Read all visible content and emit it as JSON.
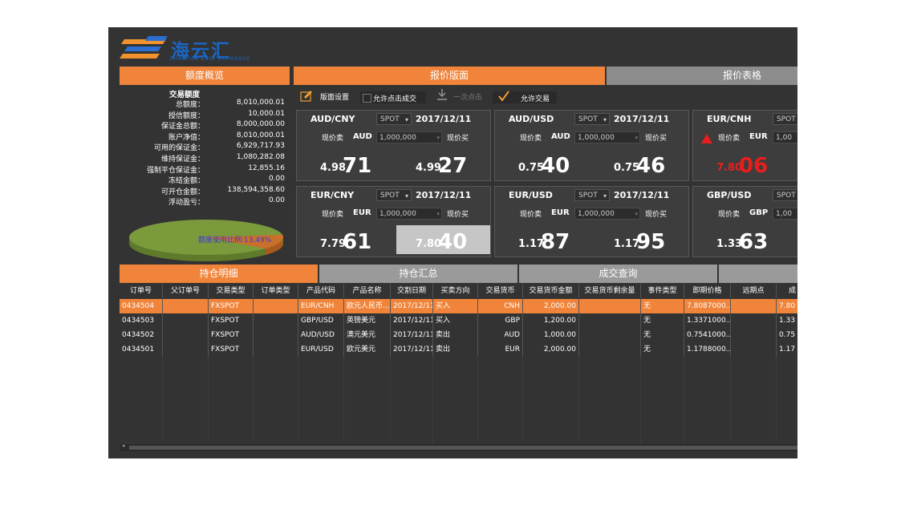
{
  "app": {
    "logo_text": "海云汇",
    "logo_subtitle": "ZHAOYUN BUSI EXCHANGE"
  },
  "tabs_top": {
    "quota_overview": "额度概览",
    "quote_board": "报价版面",
    "quote_table": "报价表格"
  },
  "quota": {
    "title": "交易额度",
    "rows": [
      {
        "label": "总额度：",
        "value": "8,010,000.01"
      },
      {
        "label": "授信额度：",
        "value": "10,000.01"
      },
      {
        "label": "保证金总额：",
        "value": "8,000,000.00"
      },
      {
        "label": "账户净值：",
        "value": "8,010,000.01"
      },
      {
        "label": "可用的保证金：",
        "value": "6,929,717.93"
      },
      {
        "label": "维持保证金：",
        "value": "1,080,282.08"
      },
      {
        "label": "强制平仓保证金：",
        "value": "12,855.16"
      },
      {
        "label": "冻结金额：",
        "value": "0.00"
      },
      {
        "label": "可开仓金额：",
        "value": "138,594,358.60"
      },
      {
        "label": "浮动盈亏：",
        "value": "0.00"
      }
    ],
    "usage_label": "额度使用比例:13.49%",
    "usage_ratio": 0.1349,
    "colors": {
      "used": "#c9702a",
      "free": "#7a9a3b"
    }
  },
  "toolbar": {
    "board_settings": "版面设置",
    "allow_click_deal": "允许点击成交",
    "one_click": "一次点击",
    "allow_trade": "允许交易"
  },
  "cards": [
    {
      "pair": "AUD/CNY",
      "type": "SPOT",
      "date": "2017/12/11",
      "sell_label": "现价卖",
      "ccy": "AUD",
      "amount": "1,000,000",
      "buy_label": "现价买",
      "sell_pre": "4.98",
      "sell_big": "71",
      "buy_pre": "4.99",
      "buy_big": "27"
    },
    {
      "pair": "AUD/USD",
      "type": "SPOT",
      "date": "2017/12/11",
      "sell_label": "现价卖",
      "ccy": "AUD",
      "amount": "1,000,000",
      "buy_label": "现价买",
      "sell_pre": "0.75",
      "sell_big": "40",
      "buy_pre": "0.75",
      "buy_big": "46"
    },
    {
      "pair": "EUR/CNH",
      "type": "SPOT",
      "date": "",
      "sell_label": "现价卖",
      "ccy": "EUR",
      "amount": "1,00",
      "buy_label": "",
      "sell_pre": "7.80",
      "sell_big": "06",
      "buy_pre": "",
      "buy_big": ""
    },
    {
      "pair": "EUR/CNY",
      "type": "SPOT",
      "date": "2017/12/11",
      "sell_label": "现价卖",
      "ccy": "EUR",
      "amount": "1,000,000",
      "buy_label": "现价买",
      "sell_pre": "7.79",
      "sell_big": "61",
      "buy_pre": "7.80",
      "buy_big": "40"
    },
    {
      "pair": "EUR/USD",
      "type": "SPOT",
      "date": "2017/12/11",
      "sell_label": "现价卖",
      "ccy": "EUR",
      "amount": "1,000,000",
      "buy_label": "现价买",
      "sell_pre": "1.17",
      "sell_big": "87",
      "buy_pre": "1.17",
      "buy_big": "95"
    },
    {
      "pair": "GBP/USD",
      "type": "SPOT",
      "date": "",
      "sell_label": "现价卖",
      "ccy": "GBP",
      "amount": "1,00",
      "buy_label": "",
      "sell_pre": "1.33",
      "sell_big": "63",
      "buy_pre": "",
      "buy_big": ""
    }
  ],
  "tabs_bottom": {
    "position_detail": "持仓明细",
    "position_summary": "持仓汇总",
    "deal_query": "成交查询"
  },
  "table": {
    "columns": [
      "订单号",
      "父订单号",
      "交易类型",
      "订单类型",
      "产品代码",
      "产品名称",
      "交割日期",
      "买卖方向",
      "交易货币",
      "交易货币金额",
      "交易货币剩余量",
      "事件类型",
      "即期价格",
      "远期点",
      "成"
    ],
    "rows": [
      [
        "0434504",
        "",
        "FXSPOT",
        "",
        "EUR/CNH",
        "欧元人民币...",
        "2017/12/11",
        "买入",
        "CNH",
        "2,000.00",
        "",
        "无",
        "7.8087000...",
        "",
        "7.80"
      ],
      [
        "0434503",
        "",
        "FXSPOT",
        "",
        "GBP/USD",
        "英镑美元",
        "2017/12/11",
        "买入",
        "GBP",
        "1,200.00",
        "",
        "无",
        "1.3371000...",
        "",
        "1.33"
      ],
      [
        "0434502",
        "",
        "FXSPOT",
        "",
        "AUD/USD",
        "澳元美元",
        "2017/12/11",
        "卖出",
        "AUD",
        "1,000.00",
        "",
        "无",
        "0.7541000...",
        "",
        "0.75"
      ],
      [
        "0434501",
        "",
        "FXSPOT",
        "",
        "EUR/USD",
        "欧元美元",
        "2017/12/11",
        "卖出",
        "EUR",
        "2,000.00",
        "",
        "无",
        "1.1788000...",
        "",
        "1.17"
      ]
    ]
  },
  "accent_color": "#f0843a"
}
